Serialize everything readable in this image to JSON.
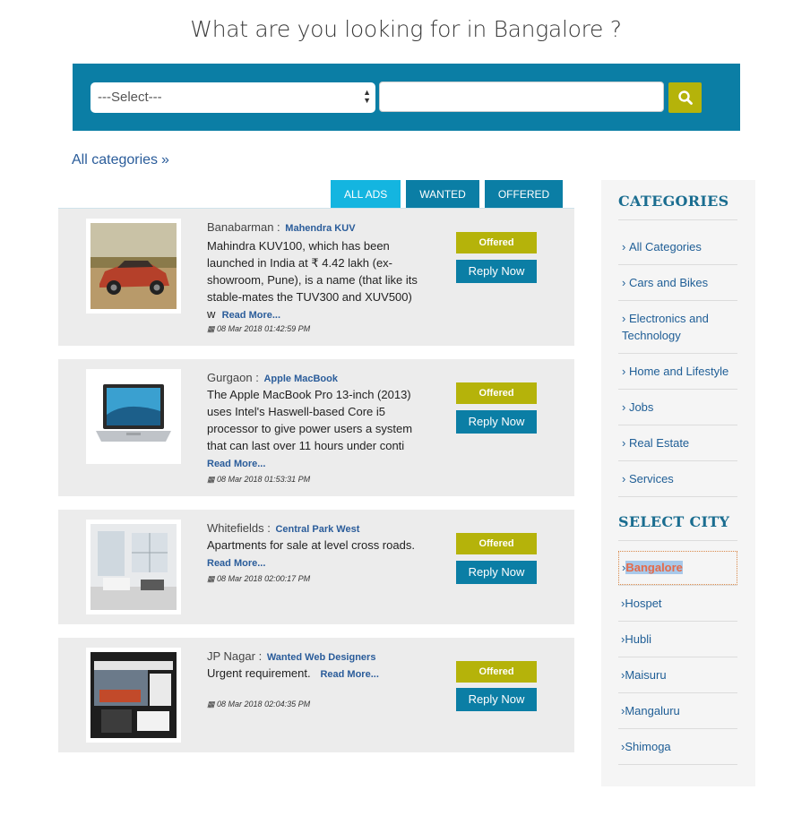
{
  "headline": "What are you looking for in Bangalore ?",
  "search": {
    "select_value": "---Select---",
    "input_value": "",
    "button_icon": "search-icon"
  },
  "all_categories": {
    "label": "All categories",
    "suffix": "»"
  },
  "tabs": [
    {
      "label": "ALL ADS"
    },
    {
      "label": "WANTED"
    },
    {
      "label": "OFFERED"
    }
  ],
  "ads": [
    {
      "location": "Banabarman :",
      "title": "Mahendra KUV",
      "description": "Mahindra KUV100, which has been launched in India at ₹ 4.42 lakh (ex-showroom, Pune), is a name (that like its stable-mates the TUV300 and XUV500) w",
      "read_more": "Read More...",
      "date": "08 Mar 2018 01:42:59 PM",
      "badge": "Offered",
      "reply": "Reply Now",
      "image": "car-photo"
    },
    {
      "location": "Gurgaon :",
      "title": "Apple MacBook",
      "description": "The Apple MacBook Pro 13-inch (2013) uses Intel's Haswell-based Core i5 processor to give power users a system that can last over 11 hours under conti",
      "read_more": "Read More...",
      "date": "08 Mar 2018 01:53:31 PM",
      "badge": "Offered",
      "reply": "Reply Now",
      "image": "laptop-photo"
    },
    {
      "location": "Whitefields :",
      "title": "Central Park West",
      "description": "Apartments for sale at level cross roads.",
      "read_more": "Read More...",
      "date": "08 Mar 2018 02:00:17 PM",
      "badge": "Offered",
      "reply": "Reply Now",
      "image": "apartment-photo"
    },
    {
      "location": "JP Nagar :",
      "title": "Wanted Web Designers",
      "description": "Urgent requirement.",
      "read_more": "Read More...",
      "date": "08 Mar 2018 02:04:35 PM",
      "badge": "Offered",
      "reply": "Reply Now",
      "image": "web-design-photo"
    }
  ],
  "sidebar": {
    "categories_heading": "CATEGORIES",
    "categories": [
      {
        "label": "All Categories"
      },
      {
        "label": "Cars and Bikes"
      },
      {
        "label": "Electronics and Technology"
      },
      {
        "label": "Home and Lifestyle"
      },
      {
        "label": "Jobs"
      },
      {
        "label": "Real Estate"
      },
      {
        "label": "Services"
      }
    ],
    "city_heading": "SELECT CITY",
    "cities": [
      {
        "label": "Bangalore",
        "selected": true
      },
      {
        "label": "Hospet"
      },
      {
        "label": "Hubli"
      },
      {
        "label": "Maisuru"
      },
      {
        "label": "Mangaluru"
      },
      {
        "label": "Shimoga"
      }
    ]
  },
  "colors": {
    "primary": "#0b7ea5",
    "tab_active": "#14b5e0",
    "accent": "#b5b30a",
    "heading": "#1a6d90",
    "link": "#1f5e96"
  }
}
